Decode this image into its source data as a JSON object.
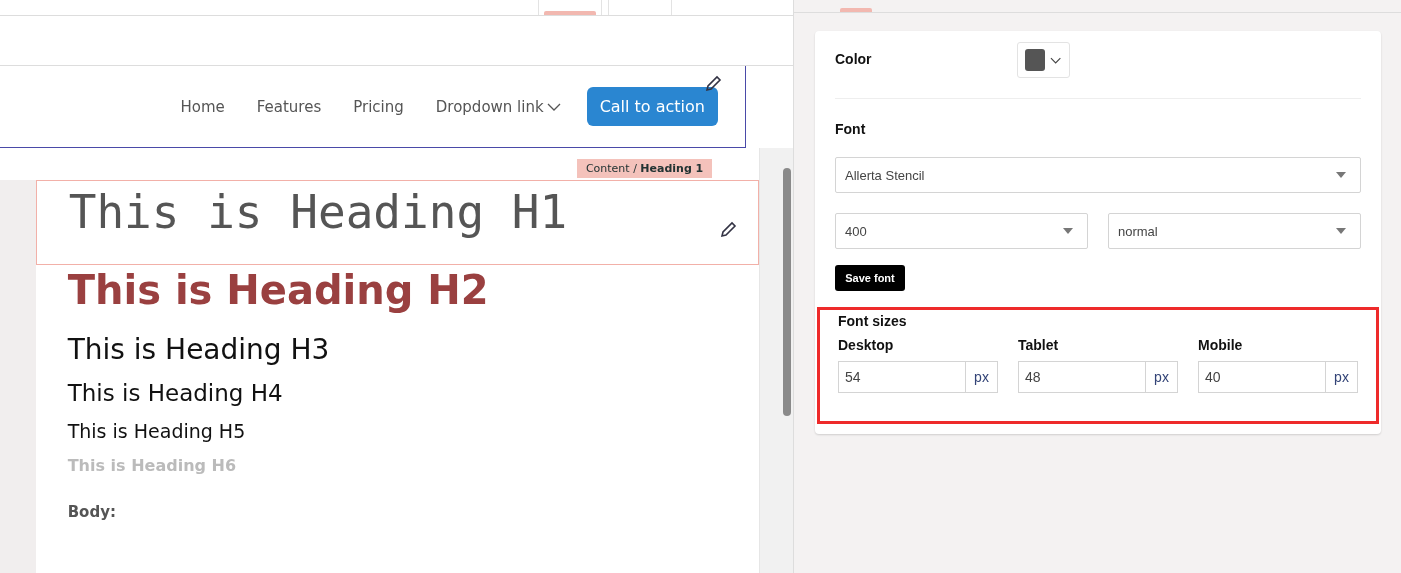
{
  "top_tabs": [
    {
      "selected": true
    },
    {
      "selected": false
    }
  ],
  "navbar": {
    "links": [
      {
        "label": "Home",
        "dropdown": false
      },
      {
        "label": "Features",
        "dropdown": false
      },
      {
        "label": "Pricing",
        "dropdown": false
      },
      {
        "label": "Dropdown link",
        "dropdown": true
      }
    ],
    "cta": "Call to action"
  },
  "selection_tag": "Content / **Heading 1**",
  "headings": [
    {
      "text": "This is Heading H1",
      "kind": "h1",
      "selected": true
    },
    {
      "text": "This is Heading H2",
      "kind": "h2",
      "selected": false
    },
    {
      "text": "This is Heading H3",
      "kind": "h3",
      "selected": false
    },
    {
      "text": "This is Heading H4",
      "kind": "h4",
      "selected": false
    },
    {
      "text": "This is Heading H5",
      "kind": "h5",
      "selected": false
    },
    {
      "text": "This is Heading H6",
      "kind": "h6",
      "selected": false
    }
  ],
  "body_label": "Body:",
  "panel": {
    "color_label": "Color",
    "color": "#555555",
    "font_label": "Font",
    "font_family": "Allerta Stencil",
    "font_weight": "400",
    "font_style": "normal",
    "save_button": "Save font",
    "sizes_label": "Font sizes",
    "highlighted": true,
    "sizes": [
      {
        "label": "Desktop",
        "value": "54",
        "unit": "px"
      },
      {
        "label": "Tablet",
        "value": "48",
        "unit": "px"
      },
      {
        "label": "Mobile",
        "value": "40",
        "unit": "px"
      }
    ]
  }
}
